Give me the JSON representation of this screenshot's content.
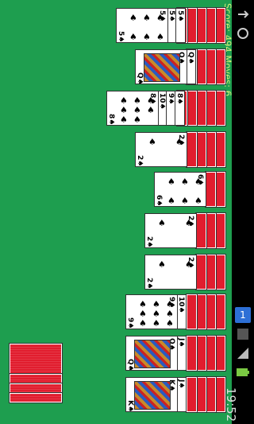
{
  "status_bar": {
    "time": "19:52",
    "notification_badge": "1",
    "icons": [
      "usb-icon",
      "update-icon",
      "notification-icon",
      "signal-icon",
      "battery-icon"
    ]
  },
  "game": {
    "score_label": "Score: 494  Moves: 6"
  },
  "colors": {
    "table": "#1e9e4f",
    "card_back": "#e11d2e",
    "score_text": "#d6ef7a"
  }
}
